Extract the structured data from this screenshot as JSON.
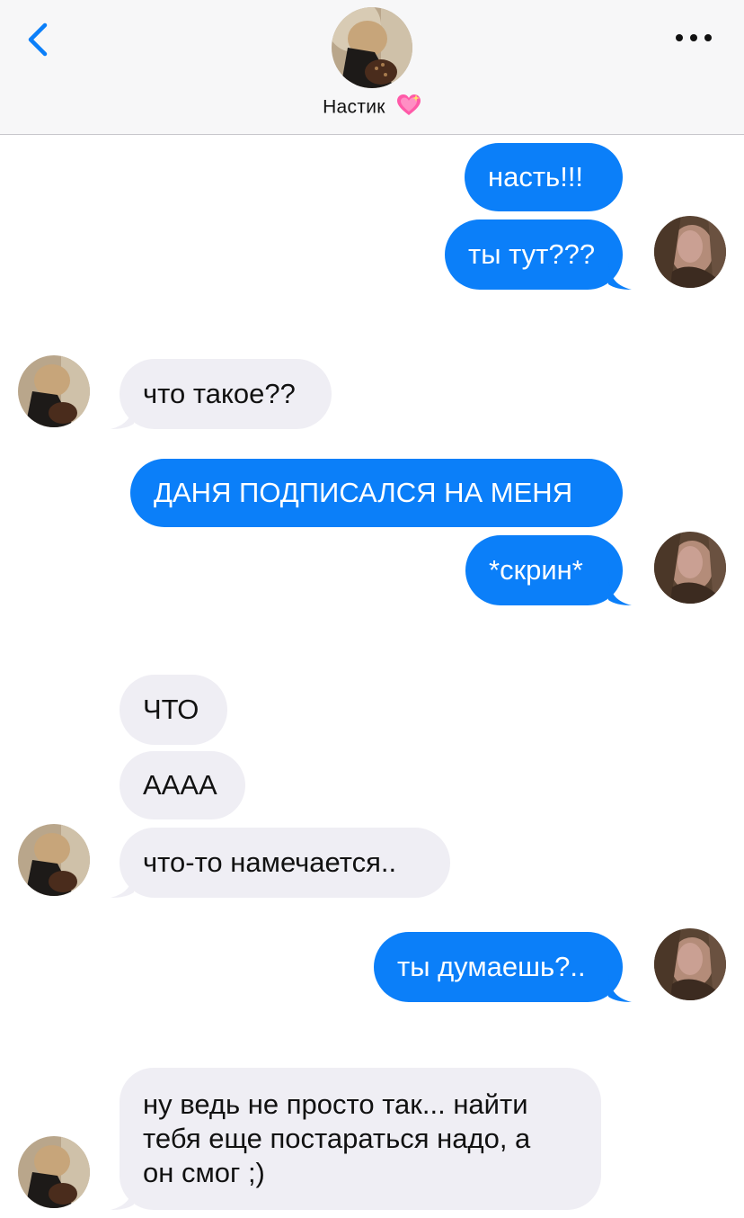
{
  "header": {
    "contact_name": "Настик",
    "name_emoji": "sparkling-heart"
  },
  "messages": [
    {
      "side": "out",
      "text": "насть!!!"
    },
    {
      "side": "out",
      "text": "ты тут???"
    },
    {
      "side": "in",
      "text": "что такое??"
    },
    {
      "side": "out",
      "text": "ДАНЯ ПОДПИСАЛСЯ НА МЕНЯ"
    },
    {
      "side": "out",
      "text": "*скрин*"
    },
    {
      "side": "in",
      "text": "ЧТО"
    },
    {
      "side": "in",
      "text": "АААА"
    },
    {
      "side": "in",
      "text": "что-то намечается.."
    },
    {
      "side": "out",
      "text": "ты думаешь?.."
    },
    {
      "side": "in",
      "lines": [
        "ну ведь не просто так... найти",
        "тебя еще постараться надо, а",
        "он смог ;)"
      ]
    }
  ],
  "colors": {
    "outgoing_bubble": "#0b7ff9",
    "incoming_bubble": "#efeef4",
    "accent": "#0b7ff9"
  }
}
